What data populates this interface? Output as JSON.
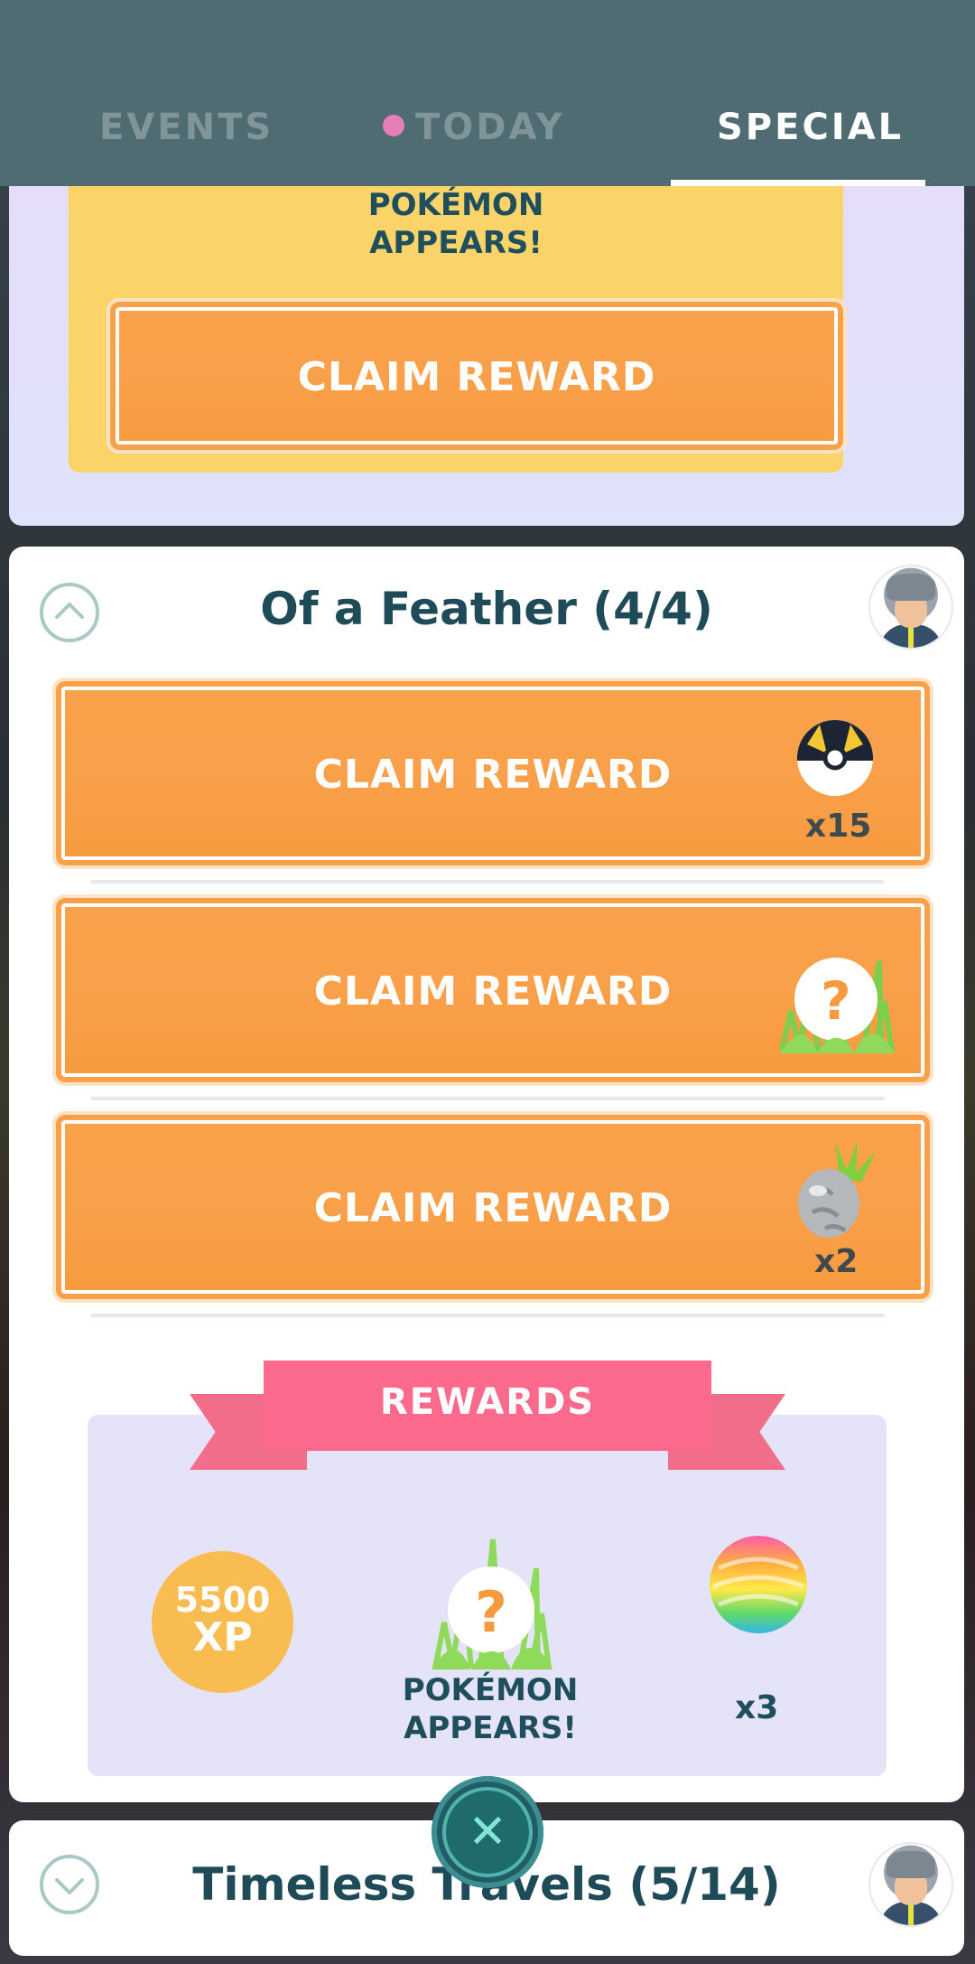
{
  "tabs": [
    {
      "label": "EVENTS",
      "active": false
    },
    {
      "label": "TODAY",
      "active": false,
      "has_dot": true
    },
    {
      "label": "SPECIAL",
      "active": true
    }
  ],
  "colors": {
    "header": "#506c73",
    "claim": "#f8a04a",
    "ribbon": "#fb6a8c",
    "xp": "#f9bc51"
  },
  "top_card": {
    "reward_label_line1": "POKÉMON",
    "reward_label_line2": "APPEARS!",
    "claim_label": "CLAIM REWARD"
  },
  "research": {
    "title": "Of a Feather (4/4)",
    "expanded": true,
    "tasks": [
      {
        "claim_label": "CLAIM REWARD",
        "reward_icon": "ultra-ball-icon",
        "quantity": "x15"
      },
      {
        "claim_label": "CLAIM REWARD",
        "reward_icon": "pokemon-encounter-icon",
        "quantity": ""
      },
      {
        "claim_label": "CLAIM REWARD",
        "reward_icon": "silver-pinap-berry-icon",
        "quantity": "x2"
      }
    ],
    "rewards": {
      "header": "REWARDS",
      "xp_value": "5500",
      "xp_unit": "XP",
      "encounter_line1": "POKÉMON",
      "encounter_line2": "APPEARS!",
      "rare_candy_quantity": "x3"
    }
  },
  "next_research": {
    "title": "Timeless Travels (5/14)",
    "expanded": false
  }
}
